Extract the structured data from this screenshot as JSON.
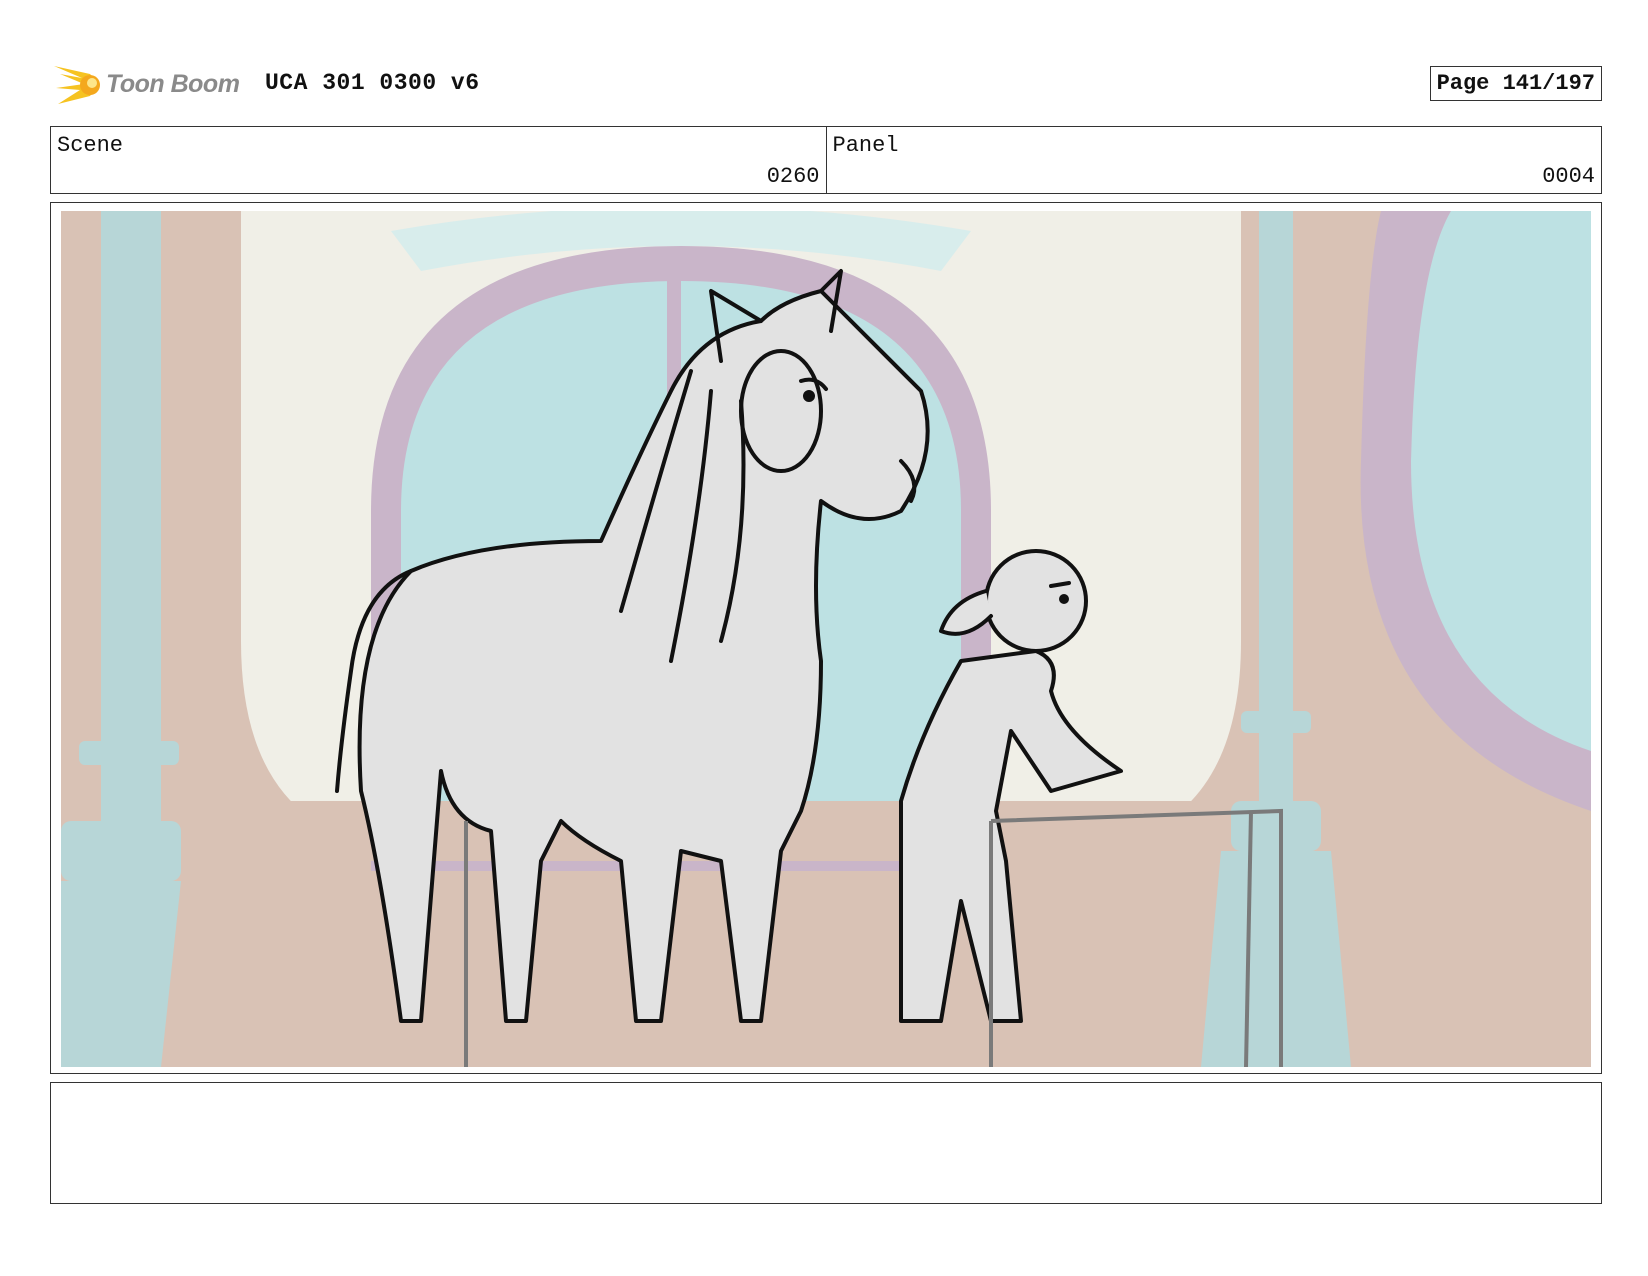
{
  "header": {
    "brand": "Toon Boom",
    "project": "UCA 301 0300 v6",
    "page": "Page 141/197"
  },
  "info": {
    "scene_label": "Scene",
    "scene_value": "0260",
    "panel_label": "Panel",
    "panel_value": "0004"
  },
  "colors": {
    "wall": "#d9c2b5",
    "arch_frame": "#f0efe7",
    "arch_trim": "#c9b5c9",
    "window": "#bde1e3",
    "pillar": "#b7d6d7",
    "sketch_fill": "#e2e2e2",
    "ink": "#111111"
  },
  "icons": [
    "toon-boom-logo-icon"
  ],
  "notes": ""
}
